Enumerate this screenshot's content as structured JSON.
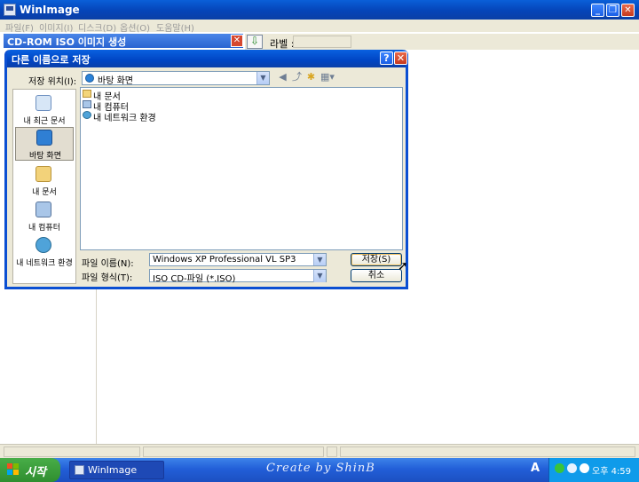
{
  "main_window": {
    "title": "WinImage",
    "menu": [
      "파일(F)",
      "이미지(I)",
      "디스크(D)",
      "옵션(O)",
      "도움말(H)"
    ]
  },
  "panel": {
    "title": "CD-ROM ISO 이미지 생성",
    "label_text": "라벨 :"
  },
  "dialog": {
    "title": "다른 이름으로 저장",
    "look_in_label": "저장 위치(I):",
    "look_in_value": "바탕 화면",
    "places": [
      {
        "label": "내 최근 문서",
        "icon": "recent-docs-icon",
        "active": false
      },
      {
        "label": "바탕 화면",
        "icon": "desktop-icon",
        "active": true
      },
      {
        "label": "내 문서",
        "icon": "my-documents-icon",
        "active": false
      },
      {
        "label": "내 컴퓨터",
        "icon": "my-computer-icon",
        "active": false
      },
      {
        "label": "내 네트워크 환경",
        "icon": "network-icon",
        "active": false
      }
    ],
    "files": [
      {
        "name": "내 문서",
        "icon": "folder-icon"
      },
      {
        "name": "내 컴퓨터",
        "icon": "computer-icon"
      },
      {
        "name": "내 네트워크 환경",
        "icon": "network-icon"
      }
    ],
    "file_name_label": "파일 이름(N):",
    "file_name_value": "Windows XP Professional VL SP3",
    "file_type_label": "파일 형식(T):",
    "file_type_value": "ISO CD-파일 (*.ISO)",
    "save_label": "저장(S)",
    "cancel_label": "취소"
  },
  "taskbar": {
    "start_label": "시작",
    "task_label": "WinImage",
    "watermark": "Create by ShinB",
    "ime": "A",
    "clock": "오후 4:59"
  },
  "colors": {
    "xp_blue": "#0a5fd8",
    "start_green": "#3a9a3a",
    "tray_blue": "#0f9bea",
    "dialog_face": "#ece9d8"
  }
}
